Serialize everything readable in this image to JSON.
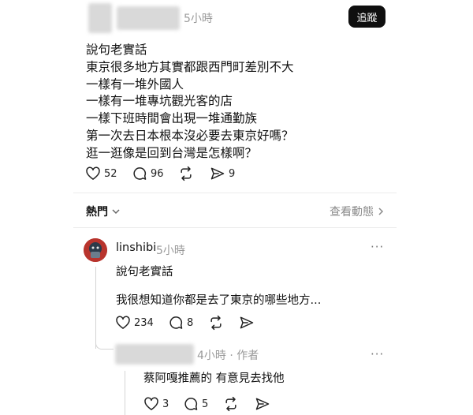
{
  "post": {
    "time": "5小時",
    "follow_label": "追蹤",
    "lines": [
      "說句老實話",
      "東京很多地方其實都跟西門町差別不大",
      "一樣有一堆外國人",
      "一樣有一堆專坑觀光客的店",
      "一樣下班時間會出現一堆通勤族",
      "第一次去日本根本沒必要去東京好嗎？",
      "逛一逛像是回到台灣是怎樣啊？"
    ],
    "actions": {
      "likes": "52",
      "comments": "96",
      "shares": "9"
    }
  },
  "replies_header": {
    "sort_label": "熱門",
    "view_activity": "查看動態"
  },
  "comment1": {
    "username": "linshibi",
    "time": "5小時",
    "more": "···",
    "lines": [
      "說句老實話",
      "我很想知道你都是去了東京的哪些地方..."
    ],
    "likes": "234",
    "comments": "8"
  },
  "comment2": {
    "time": "4小時 · 作者",
    "more": "···",
    "text": "蔡阿嘎推薦的 有意見去找他",
    "likes": "3",
    "comments": "5"
  },
  "colors": {
    "follow_bg": "#0f0f0f",
    "muted": "#9a9a9a",
    "avatar": "#b8342d"
  }
}
